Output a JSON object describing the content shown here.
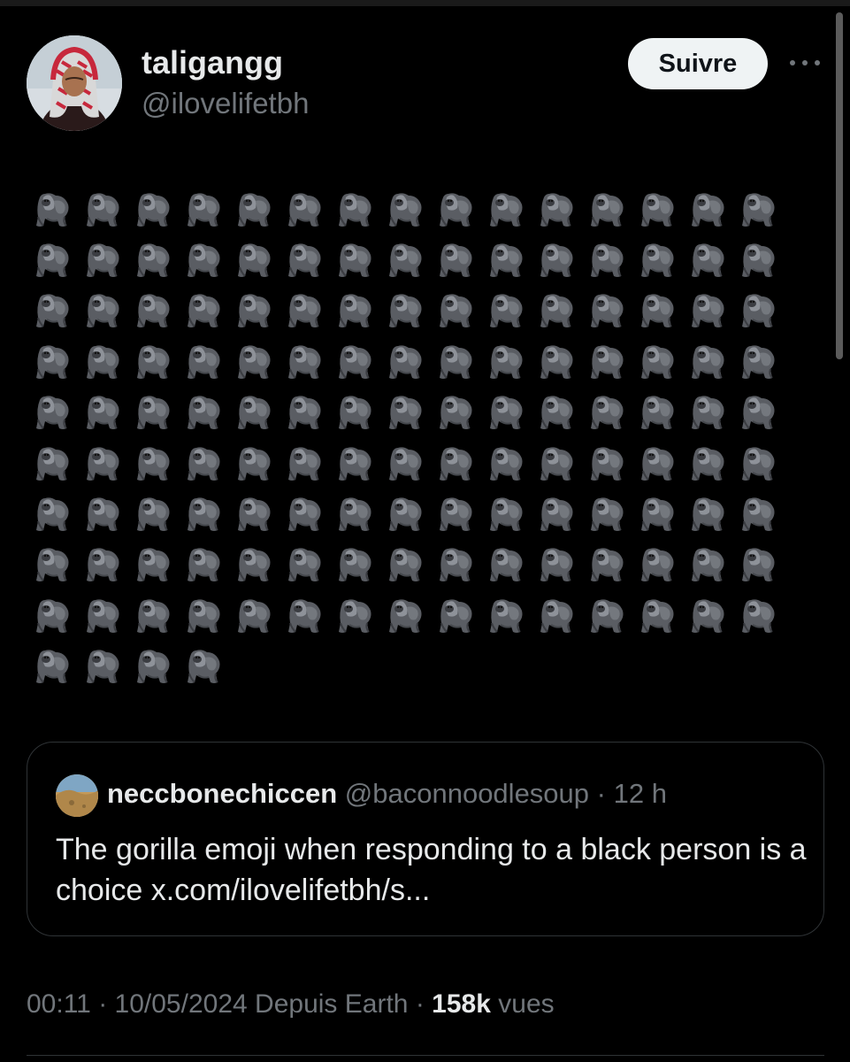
{
  "tweet": {
    "author": {
      "name": "taligangg",
      "handle": "@ilovelifetbh"
    },
    "follow_label": "Suivre",
    "more_icon": "more-horizontal-icon",
    "body": {
      "emoji_name": "gorilla",
      "emoji_icon": "gorilla-icon",
      "emoji_count": 139
    },
    "quote": {
      "name": "neccbonechiccen",
      "handle": "@baconnoodlesoup",
      "separator": "·",
      "time": "12 h",
      "text": "The gorilla emoji when responding to a black person is a choice x.com/ilovelifetbh/s..."
    },
    "meta": {
      "time": "00:11",
      "sep1": "·",
      "date": "10/05/2024",
      "source": "Depuis Earth",
      "sep2": "·",
      "views_count": "158k",
      "views_label": "vues"
    }
  },
  "colors": {
    "background": "#000000",
    "primary_text": "#e7e9ea",
    "secondary_text": "#71767b",
    "follow_button_bg": "#eff3f4",
    "border": "#2f3336"
  }
}
